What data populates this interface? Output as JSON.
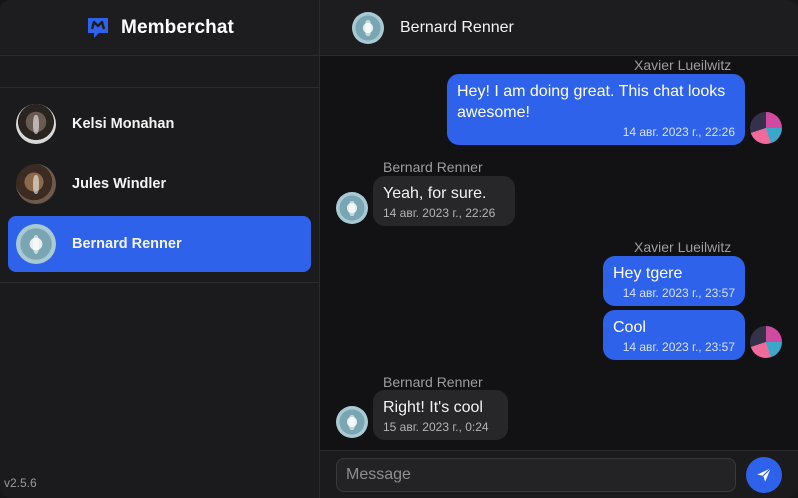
{
  "app": {
    "name": "Memberchat",
    "version": "v2.5.6",
    "accent_color": "#2f62ea"
  },
  "sidebar": {
    "contacts": [
      {
        "name": "Kelsi Monahan",
        "avatar": "avatar-photo"
      },
      {
        "name": "Jules Windler",
        "avatar": "avatar-photo"
      },
      {
        "name": "Bernard Renner",
        "avatar": "avatar-photo",
        "active": true
      }
    ]
  },
  "chat": {
    "contact_name": "Bernard Renner",
    "messages": [
      {
        "sender": "Xavier Lueilwitz",
        "text": "Hey! I am doing great. This chat looks awesome!",
        "time": "14 авг. 2023 г., 22:26",
        "direction": "outgoing"
      },
      {
        "sender": "Bernard Renner",
        "text": "Yeah, for sure.",
        "time": "14 авг. 2023 г., 22:26",
        "direction": "incoming"
      },
      {
        "sender": "Xavier Lueilwitz",
        "text": "Hey tgere",
        "time": "14 авг. 2023 г., 23:57",
        "direction": "outgoing"
      },
      {
        "sender": "",
        "text": "Cool",
        "time": "14 авг. 2023 г., 23:57",
        "direction": "outgoing"
      },
      {
        "sender": "Bernard Renner",
        "text": "Right! It's cool",
        "time": "15 авг. 2023 г., 0:24",
        "direction": "incoming"
      }
    ]
  },
  "composer": {
    "placeholder": "Message",
    "value": "",
    "send_icon": "paper-plane-icon"
  }
}
